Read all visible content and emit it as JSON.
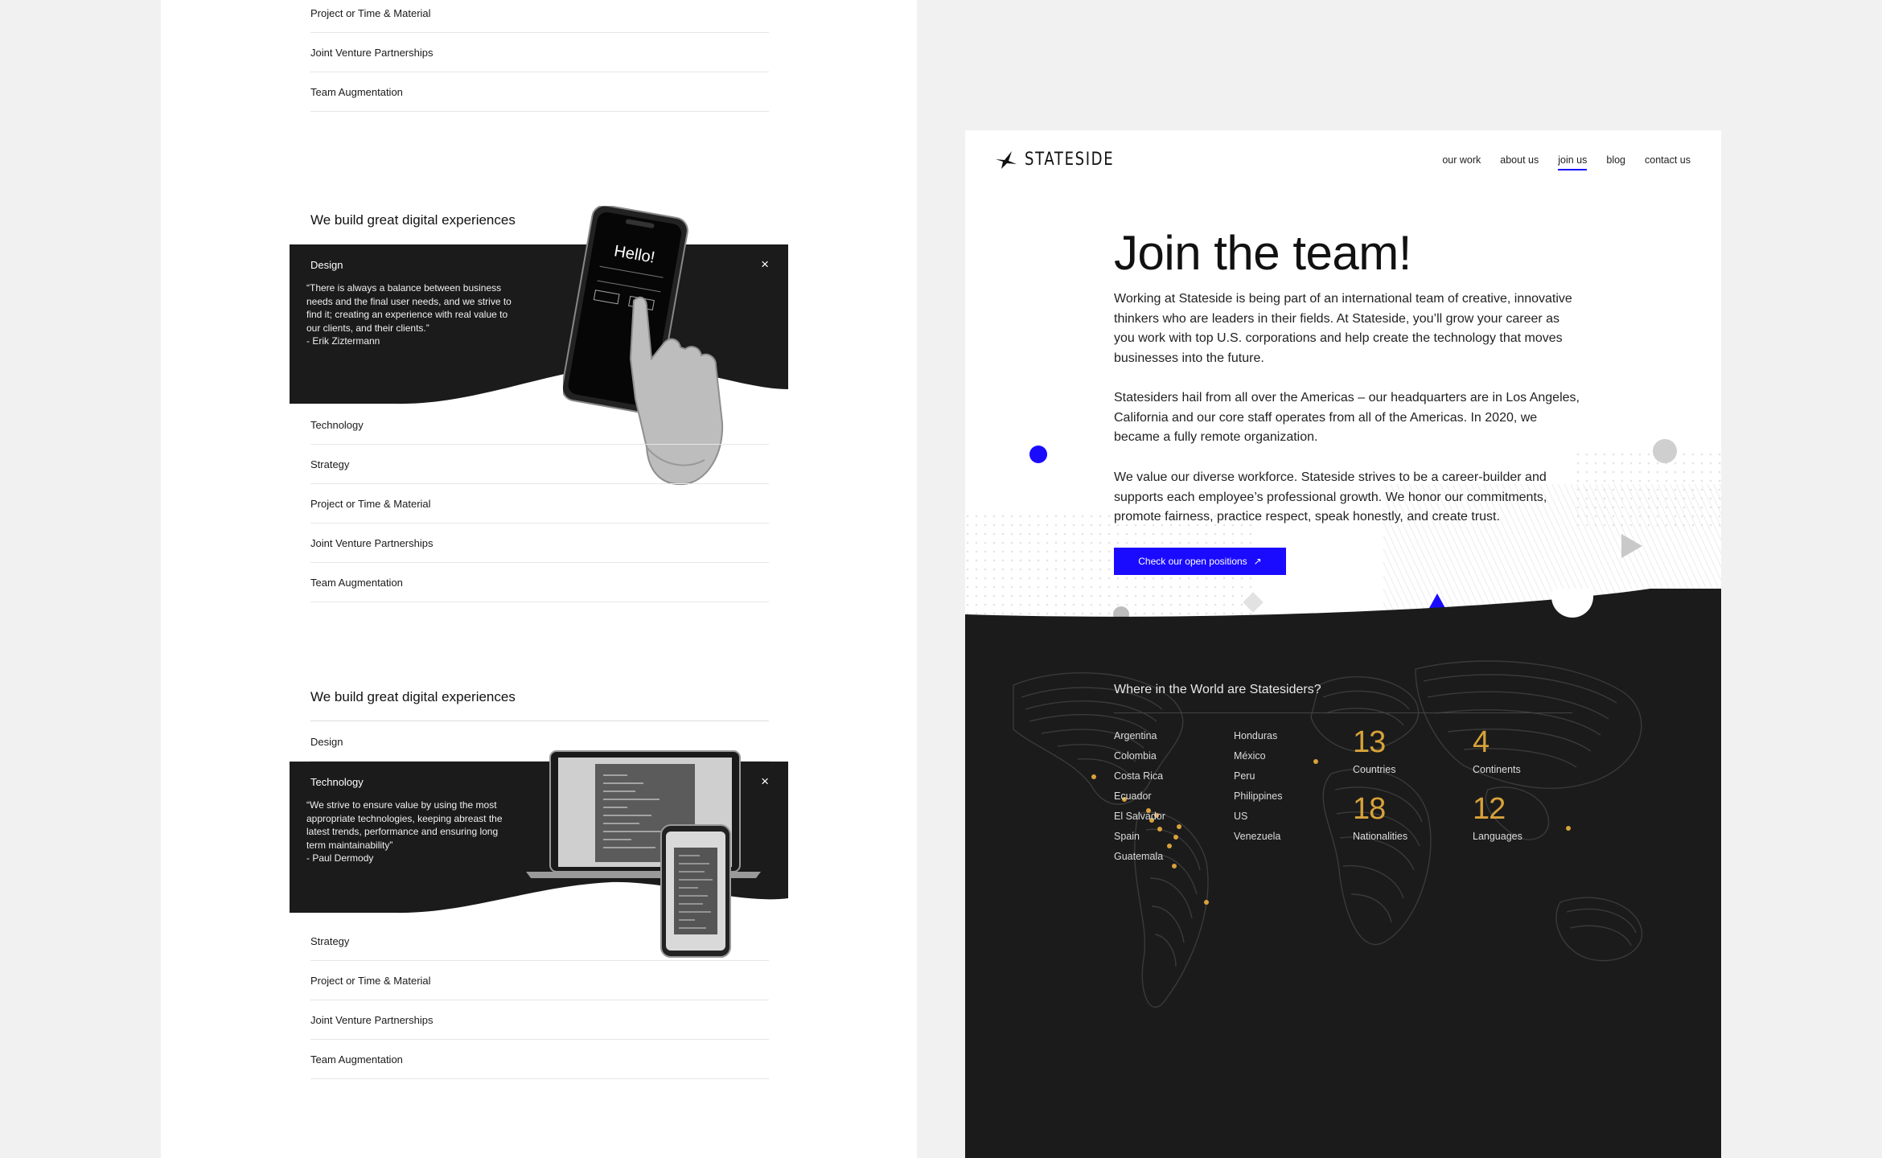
{
  "left": {
    "top_rows": [
      "Project or Time & Material",
      "Joint Venture Partnerships",
      "Team Augmentation"
    ],
    "block1": {
      "heading": "We build great digital experiences",
      "open": {
        "title": "Design",
        "quote": "“There is always a balance between business\nneeds and the final user needs, and we strive to\nfind it; creating an experience with real value to\nour clients, and their clients.”\n- Erik Ziztermann"
      },
      "rows": [
        "Technology",
        "Strategy",
        "Project or Time & Material",
        "Joint Venture Partnerships",
        "Team Augmentation"
      ],
      "phone_text": "Hello!"
    },
    "block2": {
      "heading": "We build great digital experiences",
      "first_row": "Design",
      "open": {
        "title": "Technology",
        "quote": "“We strive to ensure value by using the most\nappropriate technologies, keeping abreast the\nlatest trends, performance and ensuring long\nterm maintainability”\n- Paul Dermody"
      },
      "rows": [
        "Strategy",
        "Project or Time & Material",
        "Joint Venture Partnerships",
        "Team Augmentation"
      ]
    },
    "close_glyph": "×"
  },
  "right": {
    "logo": "STATESIDE",
    "nav": [
      "our work",
      "about us",
      "join us",
      "blog",
      "contact us"
    ],
    "title": "Join the team!",
    "p1": "Working at Stateside is being part of an international team of creative, innovative thinkers who are leaders in their fields. At Stateside, you’ll grow your career as you work with top U.S. corporations and help create the technology that moves businesses into the future.",
    "p2": "Statesiders hail from all over the Americas – our headquarters are in Los Angeles, California and our core staff operates from all of the Americas. In 2020, we became a fully remote organization.",
    "p3": "We value our diverse workforce. Stateside strives to be a career-builder and supports each employee’s professional growth. We honor our commitments, promote fairness, practice respect, speak honestly, and create trust.",
    "cta": "Check our open positions",
    "cta_arrow": "↗",
    "world_heading": "Where in the World are Statesiders?",
    "countries_col1": [
      "Argentina",
      "Colombia",
      "Costa Rica",
      "Ecuador",
      "El Salvador",
      "Spain",
      "Guatemala"
    ],
    "countries_col2": [
      "Honduras",
      "México",
      "Peru",
      "Philippines",
      "US",
      "Venezuela"
    ],
    "stats": [
      {
        "num": "13",
        "label": "Countries"
      },
      {
        "num": "4",
        "label": "Continents"
      },
      {
        "num": "18",
        "label": "Nationalities"
      },
      {
        "num": "12",
        "label": "Languages"
      }
    ]
  },
  "colors": {
    "accent": "#1a0bff",
    "gold": "#d8a23a",
    "dark": "#1b1b1b"
  }
}
